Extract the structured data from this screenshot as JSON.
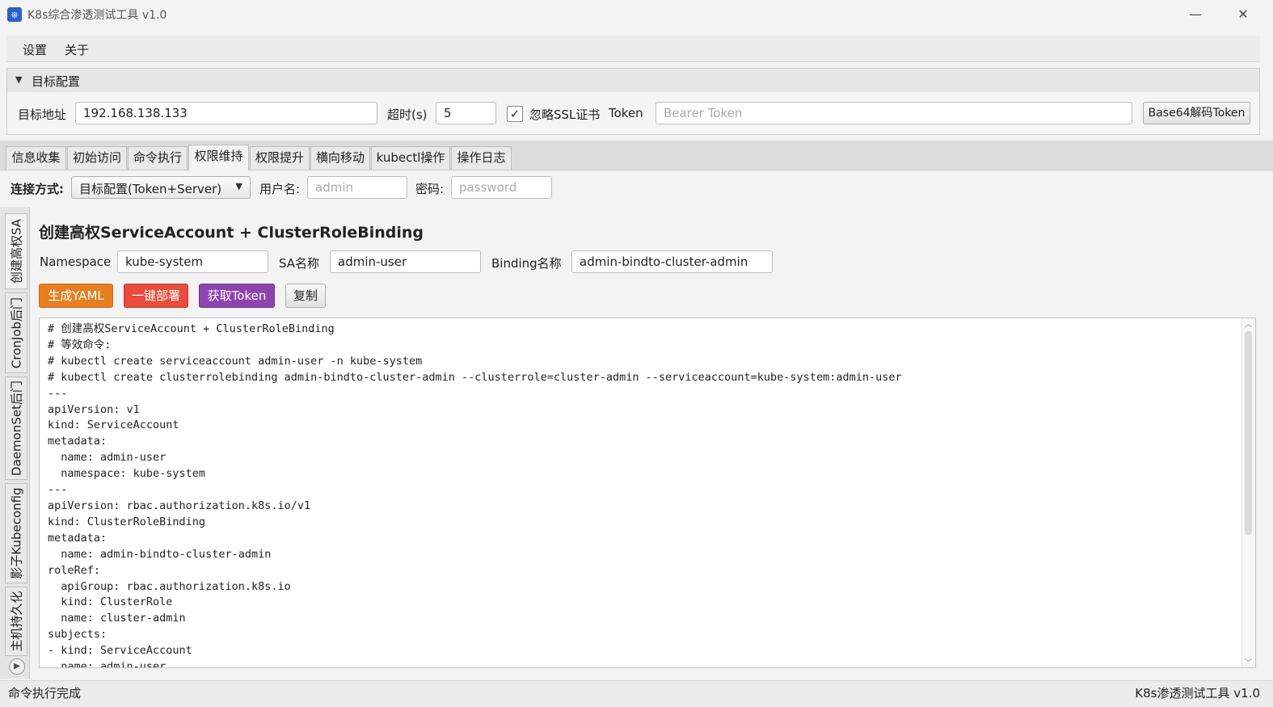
{
  "window": {
    "title": "K8s综合渗透测试工具 v1.0",
    "minimize": "—",
    "maximize": "☐",
    "close": "✕"
  },
  "menu": [
    "设置",
    "关于"
  ],
  "target_config": {
    "header": "目标配置",
    "address_label": "目标地址",
    "address_value": "192.168.138.133",
    "timeout_label": "超时(s)",
    "timeout_value": "5",
    "ignore_ssl_label": "忽略SSL证书",
    "ignore_ssl_checked": true,
    "token_label": "Token",
    "token_placeholder": "Bearer Token",
    "decode_button": "Base64解码Token"
  },
  "tabs": [
    "信息收集",
    "初始访问",
    "命令执行",
    "权限维持",
    "权限提升",
    "横向移动",
    "kubectl操作",
    "操作日志"
  ],
  "active_tab": "权限维持",
  "connection": {
    "mode_label": "连接方式:",
    "mode_value": "目标配置(Token+Server)",
    "username_label": "用户名:",
    "username_placeholder": "admin",
    "password_label": "密码:",
    "password_placeholder": "password"
  },
  "side_tabs": [
    "创建高权SA",
    "CronJob后门",
    "DaemonSet后门",
    "影子Kubeconfig",
    "主机持久化"
  ],
  "active_side_tab": "创建高权SA",
  "form": {
    "title": "创建高权ServiceAccount + ClusterRoleBinding",
    "namespace_label": "Namespace",
    "namespace_value": "kube-system",
    "sa_label": "SA名称",
    "sa_value": "admin-user",
    "binding_label": "Binding名称",
    "binding_value": "admin-bindto-cluster-admin"
  },
  "buttons": {
    "generate": "生成YAML",
    "deploy": "一键部署",
    "get_token": "获取Token",
    "copy": "复制"
  },
  "colors": {
    "generate": "#e67e22",
    "deploy": "#e74c3c",
    "get_token": "#8e44ad",
    "title_icon": "#2a62c9"
  },
  "yaml_lines": [
    "# 创建高权ServiceAccount + ClusterRoleBinding",
    "# 等效命令:",
    "# kubectl create serviceaccount admin-user -n kube-system",
    "# kubectl create clusterrolebinding admin-bindto-cluster-admin --clusterrole=cluster-admin --serviceaccount=kube-system:admin-user",
    "---",
    "apiVersion: v1",
    "kind: ServiceAccount",
    "metadata:",
    "  name: admin-user",
    "  namespace: kube-system",
    "---",
    "apiVersion: rbac.authorization.k8s.io/v1",
    "kind: ClusterRoleBinding",
    "metadata:",
    "  name: admin-bindto-cluster-admin",
    "roleRef:",
    "  apiGroup: rbac.authorization.k8s.io",
    "  kind: ClusterRole",
    "  name: cluster-admin",
    "subjects:",
    "- kind: ServiceAccount",
    "  name: admin-user"
  ],
  "status": {
    "left": "命令执行完成",
    "right": "K8s渗透测试工具 v1.0"
  }
}
